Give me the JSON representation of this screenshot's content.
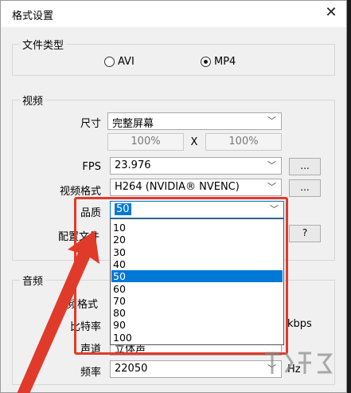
{
  "dialog": {
    "title": "格式设置",
    "close_symbol": "✕"
  },
  "file_type": {
    "label": "文件类型",
    "options": [
      {
        "label": "AVI",
        "selected": false
      },
      {
        "label": "MP4",
        "selected": true
      }
    ]
  },
  "video": {
    "label": "视频",
    "size_label": "尺寸",
    "size_value": "完整屏幕",
    "width_pct": "100%",
    "x_sep": "X",
    "height_pct": "100%",
    "fps_label": "FPS",
    "fps_value": "23.976",
    "fps_btn": "...",
    "format_label": "视频格式",
    "format_value": "H264 (NVIDIA® NVENC)",
    "format_btn": "...",
    "quality_label": "品质",
    "quality_value": "50",
    "profile_label_partial": "配置文件",
    "help_btn": "?",
    "quality_options": [
      "10",
      "20",
      "30",
      "40",
      "50",
      "60",
      "70",
      "80",
      "90",
      "100"
    ],
    "quality_selected_index": 4
  },
  "audio": {
    "label": "音频",
    "format_label_partial": "音频格式",
    "bitrate_label": "比特率",
    "bitrate_unit": "kbps",
    "channel_label": "声道",
    "channel_value_partial": "立体声",
    "freq_label": "频率",
    "freq_value": "22050",
    "freq_unit": "Hz"
  },
  "colors": {
    "highlight": "#e03b2a",
    "selection": "#0078d7"
  }
}
